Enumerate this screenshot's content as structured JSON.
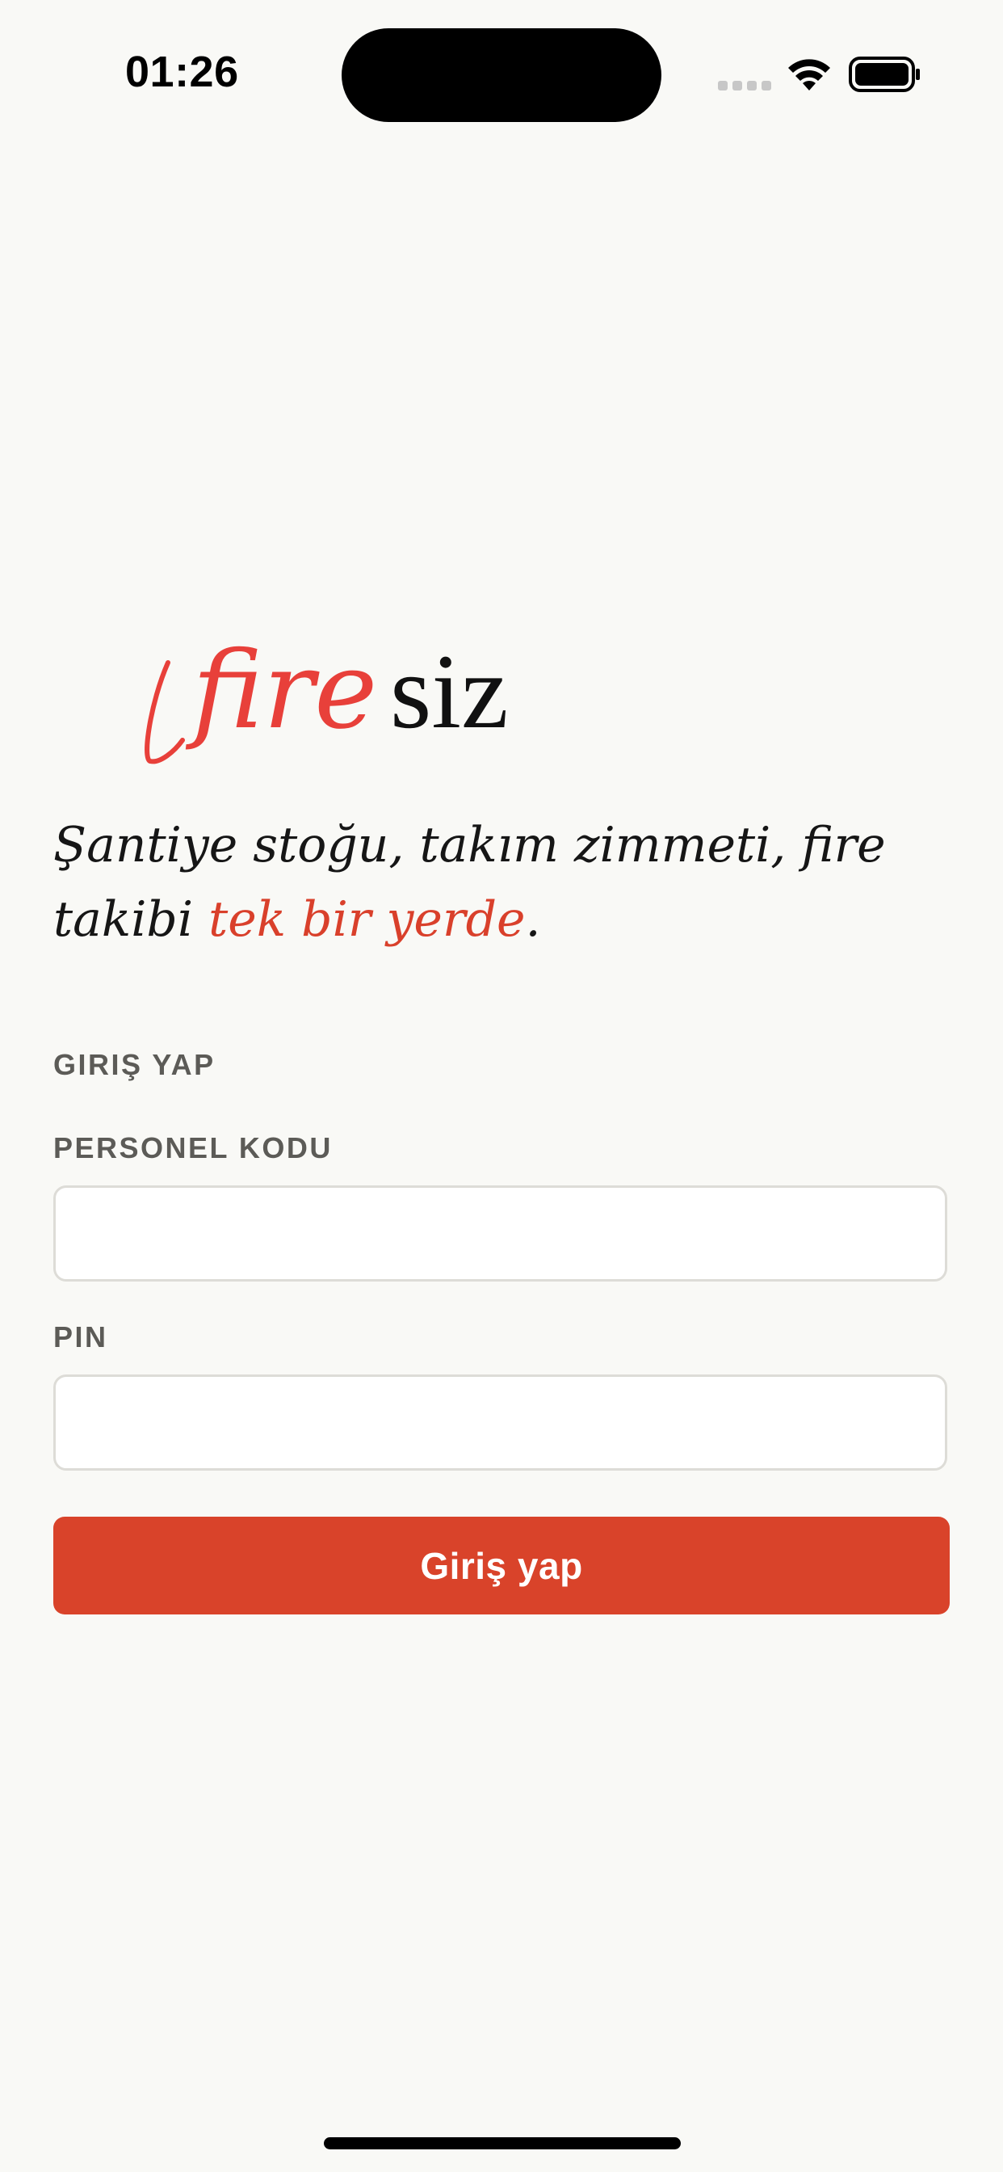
{
  "status_bar": {
    "time": "01:26",
    "icons": [
      "cellular-signal-icon",
      "wifi-icon",
      "battery-icon"
    ]
  },
  "logo": {
    "text_accent": "fire",
    "text_main": "siz",
    "accent_color": "#e8403a"
  },
  "tagline": {
    "text": "Şantiye stoğu, takım zimmeti, fire takibi ",
    "highlight": "tek bir yerde",
    "end": ".",
    "highlight_color": "#d9402b"
  },
  "form": {
    "section_title": "GIRIŞ YAP",
    "personnel_code": {
      "label": "PERSONEL KODU",
      "value": ""
    },
    "pin": {
      "label": "PIN",
      "value": ""
    },
    "submit_label": "Giriş yap",
    "submit_color": "#d9432a"
  },
  "colors": {
    "background": "#f9f9f6",
    "label": "#5c5b57",
    "input_border": "#dddcd7"
  }
}
